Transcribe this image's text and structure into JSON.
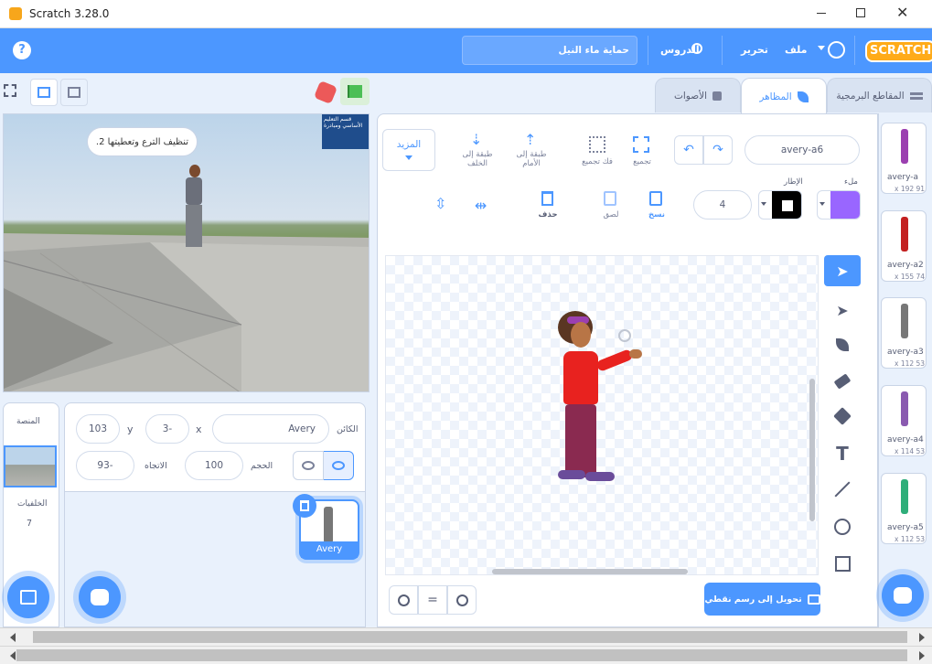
{
  "window": {
    "title": "Scratch 3.28.0"
  },
  "menu": {
    "project_title": "حماية ماء النيل",
    "tutorials": "الدروس",
    "edit": "تحرير",
    "file": "ملف",
    "logo_text": "SCRATCH"
  },
  "tabs": [
    {
      "label": "المقاطع البرمجية"
    },
    {
      "label": "المظاهر"
    },
    {
      "label": "الأصوات"
    }
  ],
  "stage": {
    "speech": ".تنظيف الترع وتعطيتها 2",
    "thumb_text": "قسم التعليم الأساسي ومبادرة"
  },
  "sprite_info": {
    "sprite_label": "الكائن",
    "sprite_name": "Avery",
    "x_label": "x",
    "x_value": "3-",
    "y_label": "y",
    "y_value": "103",
    "show_label": "",
    "size_label": "الحجم",
    "size_value": "100",
    "direction_label": "الاتجاه",
    "direction_value": "93-"
  },
  "sprites": [
    {
      "name": "Avery"
    }
  ],
  "stage_panel": {
    "title": "المنصة",
    "backdrops_label": "الخلفيات",
    "backdrops_count": "7"
  },
  "editor": {
    "costume_name": "avery-a6",
    "group": "تجميع",
    "ungroup": "فك تجميع",
    "forward": "طبقة إلى الأمام",
    "backward": "طبقة إلى الخلف",
    "more": "المزيد",
    "fill_label": "ملء",
    "outline_label": "الإطار",
    "outline_width": "4",
    "copy": "نسخ",
    "paste": "لصق",
    "delete": "حذف",
    "convert_bitmap": "تحويل إلى رسم نقطي",
    "fill_color": "#9966ff",
    "outline_color": "#000000"
  },
  "costumes": [
    {
      "name": "avery-a",
      "size": "x 192 91"
    },
    {
      "name": "avery-a2",
      "size": "x 155 74"
    },
    {
      "name": "avery-a3",
      "size": "x 112 53"
    },
    {
      "name": "avery-a4",
      "size": "x 114 53"
    },
    {
      "name": "avery-a5",
      "size": "x 112 53"
    }
  ],
  "colors": {
    "accent": "#4c97ff",
    "green_flag": "#4cbf56",
    "stop": "#ec5959"
  }
}
